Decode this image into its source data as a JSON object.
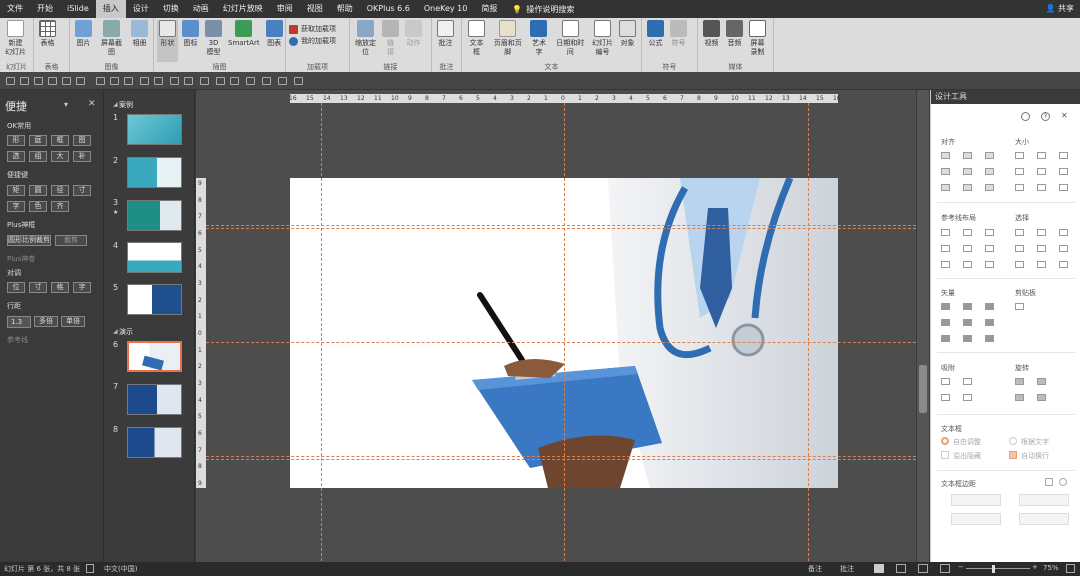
{
  "menu": {
    "tabs": [
      "文件",
      "开始",
      "iSlide",
      "插入",
      "设计",
      "切换",
      "动画",
      "幻灯片放映",
      "审阅",
      "视图",
      "帮助",
      "OKPlus 6.6",
      "OneKey 10",
      "简报"
    ],
    "search_label": "操作说明搜索",
    "share_label": "共享"
  },
  "ribbon": {
    "new_slide": "新建\n幻灯片",
    "g_slides": "幻灯片",
    "table": "表格",
    "g_table": "表格",
    "picture": "图片",
    "screenshot": "屏幕截图",
    "album": "相册",
    "g_images": "图像",
    "shapes": "形状",
    "icons": "图标",
    "models3d": "3D\n模型",
    "smartart": "SmartArt",
    "chart": "图表",
    "g_illustrations": "插图",
    "get_addins": "获取加载项",
    "my_addins": "我的加载项",
    "g_addins": "加载项",
    "zoom": "缩放定\n位",
    "link": "链\n接",
    "action": "动作",
    "g_links": "链接",
    "comment": "批注",
    "g_comments": "批注",
    "textbox": "文本框",
    "header_footer": "页眉和页脚",
    "wordart": "艺术字",
    "datetime": "日期和时间",
    "slide_number": "幻灯片\n编号",
    "object": "对象",
    "g_text": "文本",
    "equation": "公式",
    "symbol": "符号",
    "g_symbols": "符号",
    "video": "视频",
    "audio": "音频",
    "screen_record": "屏幕\n录制",
    "g_media": "媒体"
  },
  "left_panel": {
    "title": "便捷",
    "ok_label": "OK常用",
    "row1": [
      "形",
      "庭",
      "框",
      "图"
    ],
    "row2": [
      "选",
      "组",
      "大",
      "补"
    ],
    "quick_label": "便捷键",
    "row3": [
      "矩",
      "圆",
      "径",
      "寸"
    ],
    "row4": [
      "字",
      "色",
      "齐"
    ],
    "plus_label": "Plus神框",
    "plus_btn1": "圆形比例裁剪",
    "plus_btn2": "裁剪",
    "plus_transform": "Plus神卷",
    "align_label": "对调",
    "row5": [
      "位",
      "寸",
      "格",
      "字"
    ],
    "spacing_label": "行距",
    "spacing_value": "1.3",
    "multiple": "多倍",
    "single": "单倍",
    "ref_label": "参考线"
  },
  "slides_panel": {
    "section1": "案例",
    "section2": "演示",
    "numbers": [
      "1",
      "2",
      "3",
      "4",
      "5",
      "6",
      "7",
      "8"
    ],
    "star": "★"
  },
  "ruler": {
    "h_labels": [
      "16",
      "15",
      "14",
      "13",
      "12",
      "11",
      "10",
      "9",
      "8",
      "7",
      "6",
      "5",
      "4",
      "3",
      "2",
      "1",
      "0",
      "1",
      "2",
      "3",
      "4",
      "5",
      "6",
      "7",
      "8",
      "9",
      "10",
      "11",
      "12",
      "13",
      "14",
      "15",
      "16"
    ],
    "v_labels": [
      "9",
      "8",
      "7",
      "6",
      "5",
      "4",
      "3",
      "2",
      "1",
      "0",
      "1",
      "2",
      "3",
      "4",
      "5",
      "6",
      "7",
      "8",
      "9"
    ]
  },
  "right_panel": {
    "title": "设计工具",
    "align": "对齐",
    "size": "大小",
    "guides_layout": "参考线布局",
    "select": "选择",
    "vector": "矢量",
    "clipboard": "剪贴板",
    "mapping": "吸附",
    "rotate": "旋转",
    "textbox": "文本框",
    "autofit": "自由调整",
    "wrap": "根据文字",
    "overflow": "溢出隐藏",
    "autowrap": "自动换行",
    "margin": "文本框边距"
  },
  "status": {
    "slide_info": "幻灯片 第 6 张，共 8 张",
    "language": "中文(中国)",
    "notes": "备注",
    "comments": "批注",
    "zoom": "75%"
  },
  "colors": {
    "accent_orange": "#e8704a",
    "ribbon_bg": "#dcdcdc",
    "doctor_blue": "#2f6db3",
    "guide": "#d9804a"
  }
}
